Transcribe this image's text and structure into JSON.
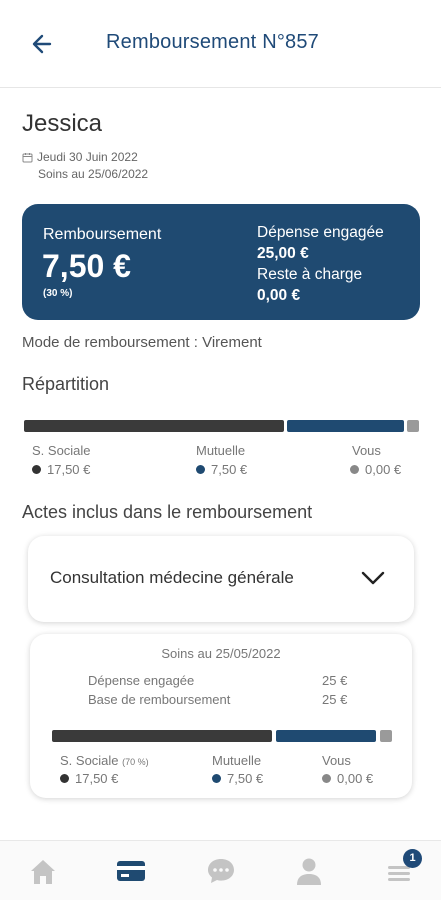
{
  "header": {
    "title": "Remboursement N°857",
    "back_icon": "arrow-left-icon"
  },
  "patient": {
    "name": "Jessica",
    "date": "Jeudi 30 Juin 2022",
    "care_date": "Soins au 25/06/2022",
    "calendar_icon": "calendar-icon"
  },
  "summary": {
    "label": "Remboursement",
    "amount": "7,50 €",
    "percent": "(30 %)",
    "spent_label": "Dépense engagée",
    "spent_value": "25,00 €",
    "rest_label": "Reste à charge",
    "rest_value": "0,00 €",
    "bg_color": "#1f4a71"
  },
  "mode": "Mode de remboursement : Virement",
  "repartition": {
    "title": "Répartition",
    "items": [
      {
        "label": "S. Sociale",
        "value": "17,50 €",
        "color": "#333333"
      },
      {
        "label": "Mutuelle",
        "value": "7,50 €",
        "color": "#1f4a71"
      },
      {
        "label": "Vous",
        "value": "0,00 €",
        "color": "#888888"
      }
    ],
    "shares": [
      0.7,
      0.3,
      0.0
    ]
  },
  "actes": {
    "title": "Actes inclus dans le remboursement",
    "card_label": "Consultation médecine générale",
    "chevron_icon": "chevron-down-icon"
  },
  "detail": {
    "care_date": "Soins au 25/05/2022",
    "spent_label": "Dépense engagée",
    "spent_value": "25 €",
    "base_label": "Base de remboursement",
    "base_value": "25 €",
    "items": [
      {
        "label": "S. Sociale",
        "sublabel": "(70 %)",
        "value": "17,50 €"
      },
      {
        "label": "Mutuelle",
        "value": "7,50 €"
      },
      {
        "label": "Vous",
        "value": "0,00 €"
      }
    ]
  },
  "nav": {
    "items": [
      "home-icon",
      "card-icon",
      "chat-icon",
      "user-icon",
      "menu-icon"
    ],
    "active": "card-icon",
    "badge": "1"
  }
}
